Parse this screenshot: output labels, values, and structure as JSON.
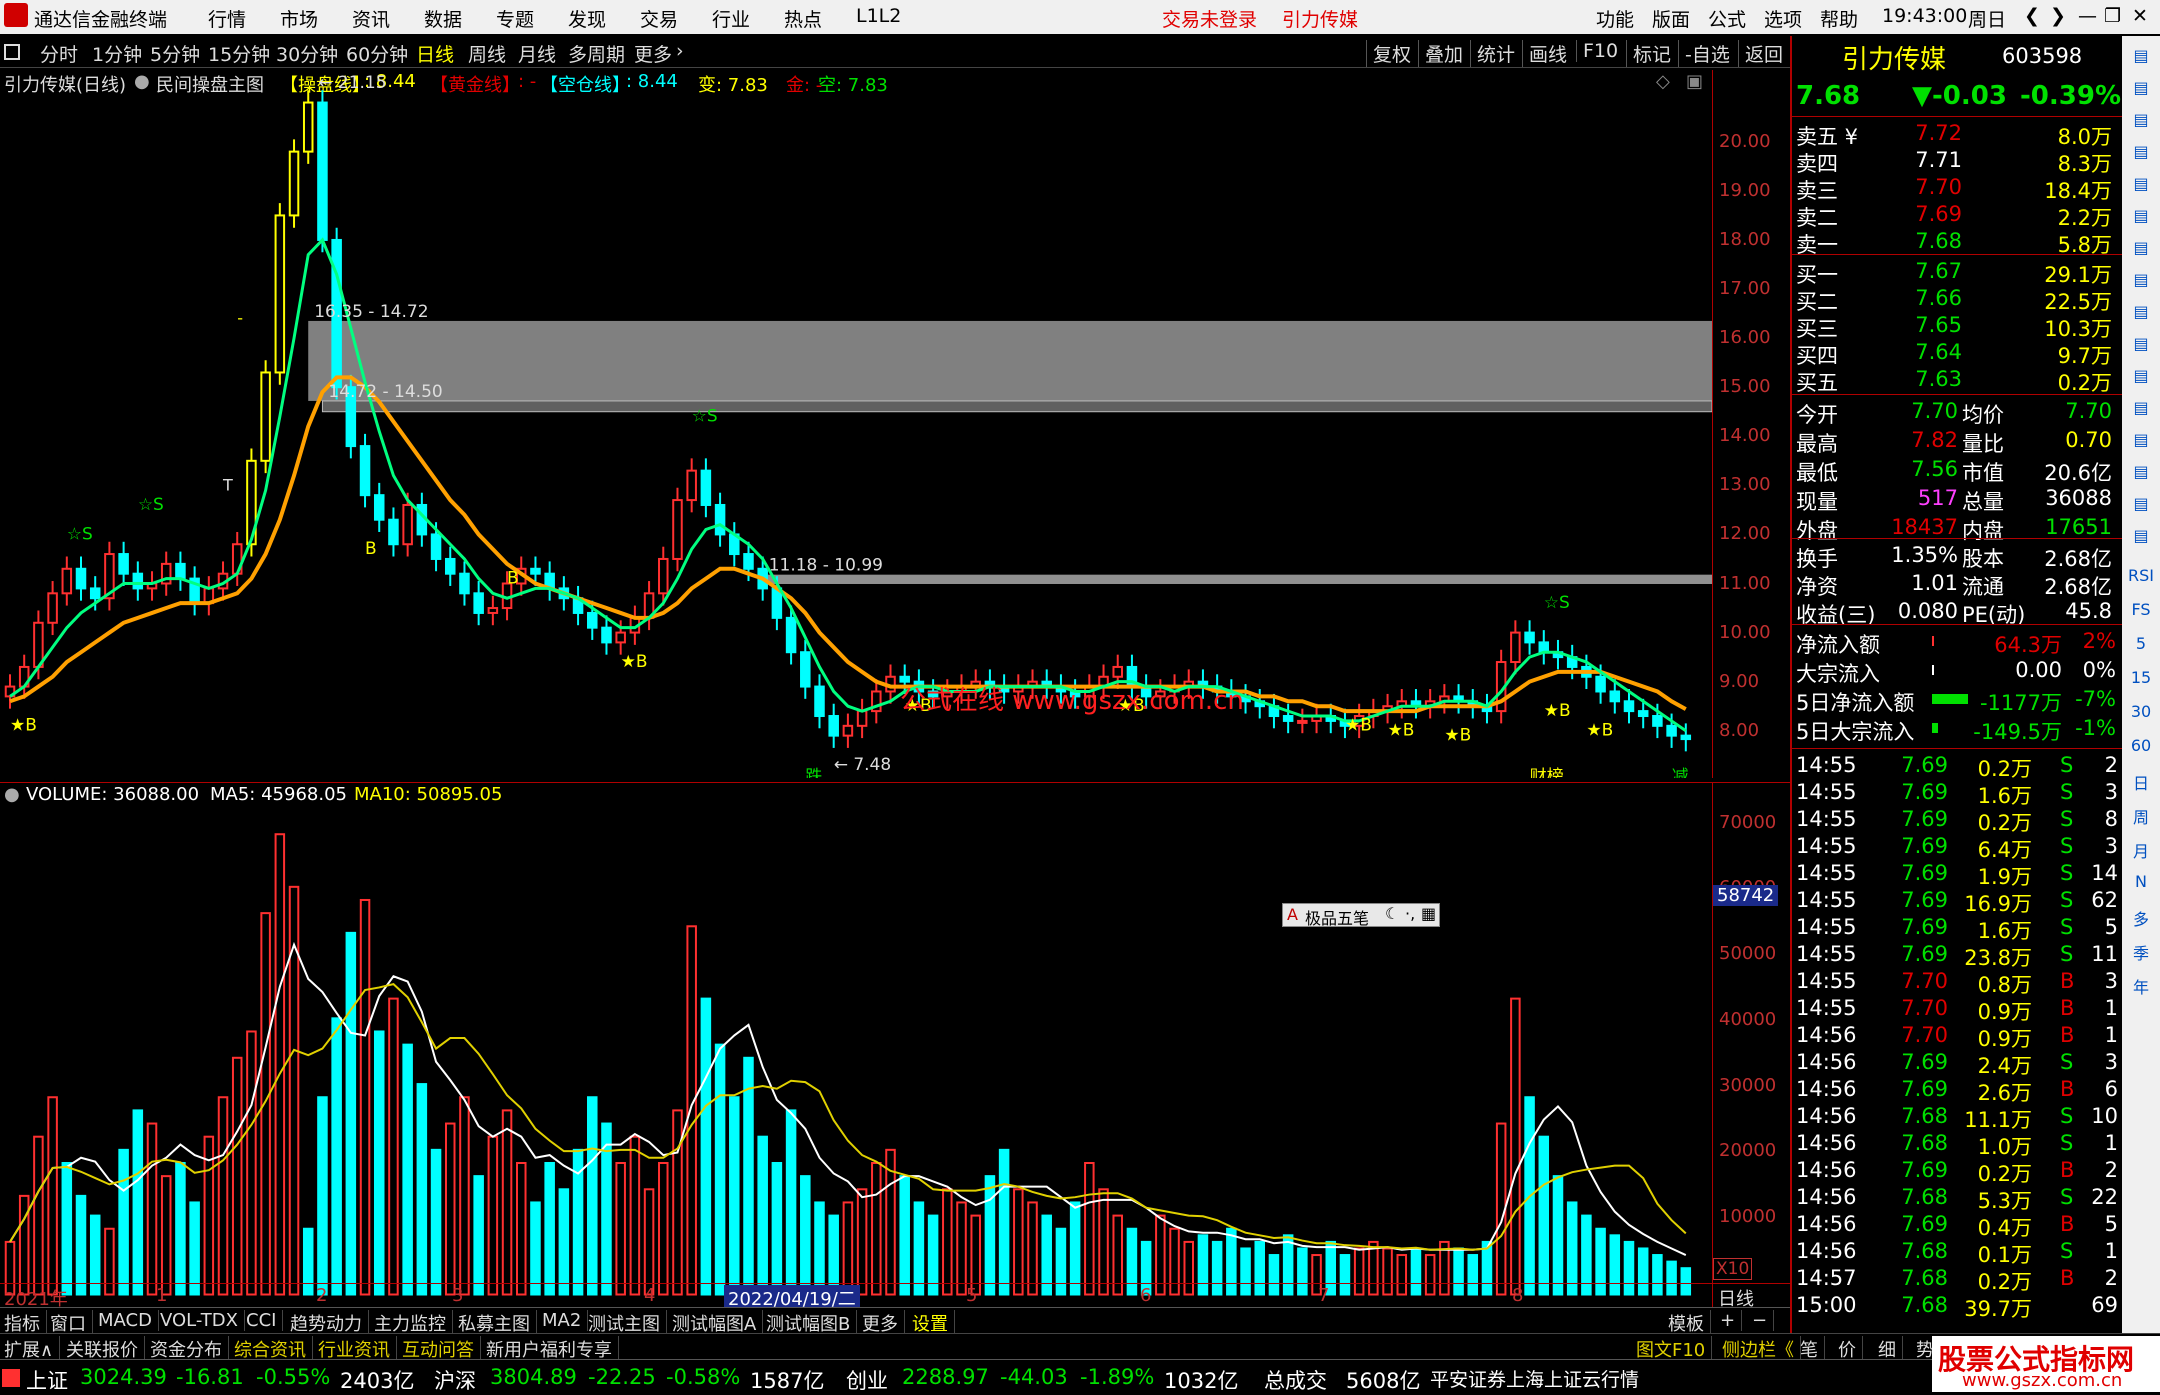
{
  "menubar": {
    "app_title": "通达信金融终端",
    "items": [
      "行情",
      "市场",
      "资讯",
      "数据",
      "专题",
      "发现",
      "交易",
      "行业",
      "热点",
      "L1L2"
    ],
    "notice_login": "交易未登录",
    "notice_stock": "引力传媒",
    "right_items": [
      "功能",
      "版面",
      "公式",
      "选项",
      "帮助"
    ],
    "time": "19:43:00",
    "weekday": "周日"
  },
  "periodbar": {
    "items": [
      "分时",
      "1分钟",
      "5分钟",
      "15分钟",
      "30分钟",
      "60分钟",
      "日线",
      "周线",
      "月线",
      "多周期",
      "更多"
    ],
    "active": "日线",
    "right_items": [
      "复权",
      "叠加",
      "统计",
      "画线",
      "F10",
      "标记",
      "-自选",
      "返回"
    ]
  },
  "legend": {
    "stock": "引力传媒(日线)",
    "indicator": "民间操盘主图",
    "line1_label": "【操盘线】",
    "line1_value": ": 8.44",
    "line2_label": "【黄金线】",
    "line2_value": ": -",
    "line3_label": "【空仓线】",
    "line3_value": ": 8.44",
    "bian": "变: 7.83",
    "jin": "金: -",
    "kong": "空: 7.83"
  },
  "chart_annotations": {
    "high_label": "21.15",
    "low_label": "7.48",
    "zone1": "16.35 - 14.72",
    "zone2": "14.72 - 14.50",
    "zone3": "11.18 - 10.99",
    "signals": [
      "☆S",
      "☆S",
      "☆S",
      "☆S",
      "★B",
      "★B",
      "★B",
      "★B",
      "★B",
      "★B",
      "★B",
      "★B",
      "★B",
      "B",
      "B",
      "T",
      "-"
    ],
    "tags": [
      "跌",
      "财榜",
      "减"
    ],
    "watermark": "公式在线 www.gszx.com.cn"
  },
  "volume_legend": {
    "volume": "VOLUME: 36088.00",
    "ma5": "MA5: 45968.05",
    "ma10": "MA10: 50895.05"
  },
  "chart_data": [
    {
      "type": "line",
      "name": "price",
      "ylim": [
        7.2,
        21.3
      ],
      "yticks": [
        "20.00",
        "19.00",
        "18.00",
        "17.00",
        "16.00",
        "15.00",
        "14.00",
        "13.00",
        "12.00",
        "11.00",
        "10.00",
        "9.00",
        "8.00"
      ],
      "close": [
        8.9,
        9.3,
        10.2,
        10.8,
        11.3,
        10.9,
        10.7,
        11.6,
        11.2,
        10.9,
        11.0,
        11.4,
        11.1,
        10.6,
        10.9,
        11.2,
        11.8,
        13.5,
        15.3,
        18.5,
        19.8,
        20.8,
        18.0,
        15.0,
        13.8,
        12.8,
        12.3,
        11.8,
        12.6,
        12.0,
        11.5,
        11.2,
        10.8,
        10.4,
        10.5,
        11.0,
        11.3,
        11.2,
        10.9,
        10.7,
        10.4,
        10.1,
        9.8,
        10.0,
        10.3,
        10.8,
        11.5,
        12.7,
        13.3,
        12.6,
        12.0,
        11.6,
        11.3,
        10.9,
        10.3,
        9.6,
        8.9,
        8.3,
        7.9,
        8.1,
        8.4,
        8.8,
        9.1,
        9.0,
        8.8,
        8.7,
        8.8,
        8.9,
        9.0,
        8.9,
        8.8,
        8.9,
        9.0,
        8.9,
        8.8,
        8.7,
        8.9,
        9.1,
        9.3,
        8.9,
        8.7,
        8.8,
        8.9,
        9.0,
        8.9,
        8.8,
        8.7,
        8.6,
        8.5,
        8.3,
        8.2,
        8.2,
        8.3,
        8.2,
        8.1,
        8.3,
        8.4,
        8.5,
        8.6,
        8.5,
        8.6,
        8.7,
        8.6,
        8.5,
        8.4,
        9.4,
        10.0,
        9.8,
        9.6,
        9.5,
        9.3,
        9.1,
        8.8,
        8.6,
        8.4,
        8.3,
        8.1,
        7.9,
        7.83
      ],
      "ma_fast": [
        8.7,
        8.9,
        9.3,
        9.7,
        10.1,
        10.4,
        10.6,
        10.8,
        11.0,
        11.0,
        11.0,
        11.1,
        11.1,
        11.0,
        10.9,
        11.0,
        11.2,
        11.9,
        12.9,
        14.4,
        16.0,
        17.7,
        18.0,
        17.3,
        16.2,
        15.1,
        14.1,
        13.2,
        12.7,
        12.4,
        12.1,
        11.8,
        11.5,
        11.1,
        10.8,
        10.7,
        10.8,
        10.9,
        10.9,
        10.8,
        10.7,
        10.5,
        10.3,
        10.1,
        10.1,
        10.3,
        10.6,
        11.1,
        11.7,
        12.1,
        12.2,
        12.0,
        11.8,
        11.5,
        11.0,
        10.5,
        9.9,
        9.3,
        8.8,
        8.5,
        8.4,
        8.5,
        8.6,
        8.8,
        8.9,
        8.9,
        8.8,
        8.8,
        8.8,
        8.9,
        8.9,
        8.9,
        8.9,
        8.9,
        8.9,
        8.8,
        8.8,
        8.9,
        9.0,
        9.0,
        8.9,
        8.9,
        8.8,
        8.9,
        8.9,
        8.9,
        8.8,
        8.7,
        8.6,
        8.5,
        8.4,
        8.3,
        8.3,
        8.3,
        8.2,
        8.2,
        8.3,
        8.4,
        8.5,
        8.5,
        8.5,
        8.6,
        8.6,
        8.6,
        8.5,
        8.8,
        9.2,
        9.5,
        9.6,
        9.6,
        9.5,
        9.4,
        9.2,
        9.0,
        8.8,
        8.6,
        8.4,
        8.2,
        8.0
      ],
      "ma_slow": [
        8.6,
        8.7,
        8.9,
        9.1,
        9.4,
        9.6,
        9.8,
        10.0,
        10.2,
        10.3,
        10.4,
        10.5,
        10.6,
        10.6,
        10.6,
        10.7,
        10.8,
        11.1,
        11.6,
        12.3,
        13.2,
        14.2,
        14.9,
        15.2,
        15.2,
        15.0,
        14.7,
        14.3,
        13.9,
        13.5,
        13.1,
        12.7,
        12.4,
        12.0,
        11.7,
        11.4,
        11.2,
        11.0,
        10.9,
        10.8,
        10.7,
        10.6,
        10.5,
        10.4,
        10.3,
        10.3,
        10.4,
        10.6,
        10.9,
        11.1,
        11.3,
        11.3,
        11.2,
        11.1,
        10.9,
        10.7,
        10.4,
        10.0,
        9.7,
        9.4,
        9.2,
        9.0,
        8.9,
        8.9,
        8.9,
        8.9,
        8.9,
        8.9,
        8.9,
        8.9,
        8.9,
        8.9,
        8.9,
        8.9,
        8.9,
        8.9,
        8.9,
        8.9,
        8.9,
        8.9,
        8.9,
        8.9,
        8.9,
        8.9,
        8.9,
        8.8,
        8.8,
        8.8,
        8.7,
        8.7,
        8.6,
        8.6,
        8.5,
        8.5,
        8.4,
        8.4,
        8.4,
        8.4,
        8.4,
        8.4,
        8.5,
        8.5,
        8.5,
        8.5,
        8.5,
        8.6,
        8.8,
        9.0,
        9.1,
        9.2,
        9.2,
        9.2,
        9.2,
        9.1,
        9.0,
        8.9,
        8.8,
        8.6,
        8.44
      ]
    },
    {
      "type": "bar",
      "name": "volume",
      "ylim": [
        0,
        73000
      ],
      "yticks": [
        "70000",
        "60000",
        "50000",
        "40000",
        "30000",
        "20000",
        "10000"
      ],
      "axis_marker": "58742",
      "multiplier": "X10",
      "values": [
        8000,
        15000,
        24000,
        30000,
        20000,
        15000,
        12000,
        10000,
        22000,
        28000,
        26000,
        18000,
        20000,
        14000,
        24000,
        30000,
        36000,
        40000,
        58000,
        70000,
        62000,
        10000,
        30000,
        42000,
        55000,
        60000,
        40000,
        45000,
        38000,
        32000,
        22000,
        26000,
        30000,
        18000,
        24000,
        28000,
        20000,
        14000,
        20000,
        16000,
        22000,
        30000,
        26000,
        20000,
        24000,
        16000,
        20000,
        28000,
        56000,
        45000,
        38000,
        30000,
        36000,
        24000,
        20000,
        28000,
        18000,
        14000,
        12000,
        14000,
        16000,
        20000,
        22000,
        18000,
        14000,
        12000,
        16000,
        14000,
        12000,
        18000,
        22000,
        16000,
        14000,
        12000,
        10000,
        14000,
        20000,
        16000,
        12000,
        10000,
        8000,
        12000,
        10000,
        8000,
        9000,
        8000,
        10000,
        7000,
        8000,
        6000,
        9000,
        7000,
        6000,
        8000,
        6000,
        7000,
        8000,
        7000,
        6000,
        7000,
        6000,
        8000,
        7000,
        6000,
        8000,
        26000,
        45000,
        30000,
        24000,
        18000,
        14000,
        12000,
        10000,
        9000,
        8000,
        7000,
        6000,
        5000,
        4000
      ],
      "up": [
        1,
        1,
        1,
        1,
        0,
        0,
        0,
        1,
        0,
        0,
        1,
        1,
        0,
        0,
        1,
        1,
        1,
        1,
        1,
        1,
        1,
        0,
        0,
        0,
        0,
        1,
        0,
        1,
        0,
        0,
        0,
        1,
        1,
        0,
        1,
        1,
        1,
        0,
        0,
        0,
        0,
        0,
        0,
        1,
        1,
        1,
        1,
        1,
        1,
        0,
        0,
        0,
        0,
        0,
        0,
        0,
        0,
        0,
        0,
        1,
        1,
        1,
        1,
        0,
        0,
        0,
        1,
        1,
        1,
        0,
        0,
        1,
        1,
        0,
        0,
        0,
        1,
        1,
        1,
        0,
        0,
        1,
        1,
        1,
        0,
        0,
        0,
        0,
        0,
        0,
        0,
        0,
        1,
        0,
        0,
        1,
        1,
        1,
        1,
        0,
        1,
        1,
        0,
        0,
        0,
        1,
        1,
        0,
        0,
        0,
        0,
        0,
        0,
        0,
        0,
        0,
        0,
        0,
        0,
        0
      ]
    }
  ],
  "date_axis": {
    "labels": [
      "2021年",
      "1",
      "2",
      "3",
      "4",
      "2022/04/19/二",
      "5",
      "6",
      "7",
      "8",
      "9"
    ],
    "right_label": "日线"
  },
  "tabs1": [
    "指标",
    "窗口",
    "MACD",
    "VOL-TDX",
    "CCI",
    "趋势动力",
    "主力监控",
    "私募主图",
    "MA2",
    "测试主图",
    "测试幅图A",
    "测试幅图B",
    "更多",
    "设置"
  ],
  "tabs1_right": [
    "模板",
    "+",
    "−"
  ],
  "tabs2": [
    "扩展∧",
    "关联报价",
    "资金分布",
    "综合资讯",
    "行业资讯",
    "互动问答",
    "新用户福利专享"
  ],
  "tabs2_right": [
    "图文F10",
    "侧边栏《",
    "笔",
    "价",
    "细",
    "势"
  ],
  "indexbar": {
    "sh_name": "上证",
    "sh_val": "3024.39",
    "sh_chg": "-16.81",
    "sh_pct": "-0.55%",
    "sh_amt": "2403亿",
    "hs_name": "沪深",
    "hs_val": "3804.89",
    "hs_chg": "-22.25",
    "hs_pct": "-0.58%",
    "hs_amt": "1587亿",
    "cy_name": "创业",
    "cy_val": "2288.97",
    "cy_chg": "-44.03",
    "cy_pct": "-1.89%",
    "cy_amt": "1032亿",
    "total_label": "总成交",
    "total_amt": "5608亿",
    "broker": "平安证券上海上证云行情"
  },
  "quote": {
    "name": "引力传媒",
    "code": "603598",
    "price": "7.68",
    "change": "▼-0.03",
    "pct": "-0.39%",
    "asks": [
      {
        "label": "卖五 ¥",
        "price": "7.72",
        "vol": "8.0万"
      },
      {
        "label": "卖四",
        "price": "7.71",
        "vol": "8.3万"
      },
      {
        "label": "卖三",
        "price": "7.70",
        "vol": "18.4万"
      },
      {
        "label": "卖二",
        "price": "7.69",
        "vol": "2.2万"
      },
      {
        "label": "卖一",
        "price": "7.68",
        "vol": "5.8万"
      }
    ],
    "bids": [
      {
        "label": "买一",
        "price": "7.67",
        "vol": "29.1万"
      },
      {
        "label": "买二",
        "price": "7.66",
        "vol": "22.5万"
      },
      {
        "label": "买三",
        "price": "7.65",
        "vol": "10.3万"
      },
      {
        "label": "买四",
        "price": "7.64",
        "vol": "9.7万"
      },
      {
        "label": "买五",
        "price": "7.63",
        "vol": "0.2万"
      }
    ],
    "stats": [
      {
        "l1": "今开",
        "v1": "7.70",
        "l2": "均价",
        "v2": "7.70"
      },
      {
        "l1": "最高",
        "v1": "7.82",
        "l2": "量比",
        "v2": "0.70"
      },
      {
        "l1": "最低",
        "v1": "7.56",
        "l2": "市值",
        "v2": "20.6亿"
      },
      {
        "l1": "现量",
        "v1": "517",
        "l2": "总量",
        "v2": "36088"
      },
      {
        "l1": "外盘",
        "v1": "18437",
        "l2": "内盘",
        "v2": "17651"
      }
    ],
    "fund": [
      {
        "l1": "换手",
        "v1": "1.35%",
        "l2": "股本",
        "v2": "2.68亿"
      },
      {
        "l1": "净资",
        "v1": "1.01",
        "l2": "流通",
        "v2": "2.68亿"
      },
      {
        "l1": "收益(三)",
        "v1": "0.080",
        "l2": "PE(动)",
        "v2": "45.8"
      }
    ],
    "flow": [
      {
        "label": "净流入额",
        "val": "64.3万",
        "pct": "2%"
      },
      {
        "label": "大宗流入",
        "val": "0.00",
        "pct": "0%"
      },
      {
        "label": "5日净流入额",
        "val": "-1177万",
        "pct": "-7%"
      },
      {
        "label": "5日大宗流入",
        "val": "-149.5万",
        "pct": "-1%"
      }
    ],
    "ticks": [
      {
        "t": "14:55",
        "p": "7.69",
        "v": "0.2万",
        "s": "S",
        "n": "2"
      },
      {
        "t": "14:55",
        "p": "7.69",
        "v": "1.6万",
        "s": "S",
        "n": "3"
      },
      {
        "t": "14:55",
        "p": "7.69",
        "v": "0.2万",
        "s": "S",
        "n": "8"
      },
      {
        "t": "14:55",
        "p": "7.69",
        "v": "6.4万",
        "s": "S",
        "n": "3"
      },
      {
        "t": "14:55",
        "p": "7.69",
        "v": "1.9万",
        "s": "S",
        "n": "14"
      },
      {
        "t": "14:55",
        "p": "7.69",
        "v": "16.9万",
        "s": "S",
        "n": "62"
      },
      {
        "t": "14:55",
        "p": "7.69",
        "v": "1.6万",
        "s": "S",
        "n": "5"
      },
      {
        "t": "14:55",
        "p": "7.69",
        "v": "23.8万",
        "s": "S",
        "n": "11"
      },
      {
        "t": "14:55",
        "p": "7.70",
        "v": "0.8万",
        "s": "B",
        "n": "3"
      },
      {
        "t": "14:55",
        "p": "7.70",
        "v": "0.9万",
        "s": "B",
        "n": "1"
      },
      {
        "t": "14:56",
        "p": "7.70",
        "v": "0.9万",
        "s": "B",
        "n": "1"
      },
      {
        "t": "14:56",
        "p": "7.69",
        "v": "2.4万",
        "s": "S",
        "n": "3"
      },
      {
        "t": "14:56",
        "p": "7.69",
        "v": "2.6万",
        "s": "B",
        "n": "6"
      },
      {
        "t": "14:56",
        "p": "7.68",
        "v": "11.1万",
        "s": "S",
        "n": "10"
      },
      {
        "t": "14:56",
        "p": "7.68",
        "v": "1.0万",
        "s": "S",
        "n": "1"
      },
      {
        "t": "14:56",
        "p": "7.69",
        "v": "0.2万",
        "s": "B",
        "n": "2"
      },
      {
        "t": "14:56",
        "p": "7.68",
        "v": "5.3万",
        "s": "S",
        "n": "22"
      },
      {
        "t": "14:56",
        "p": "7.69",
        "v": "0.4万",
        "s": "B",
        "n": "5"
      },
      {
        "t": "14:56",
        "p": "7.68",
        "v": "0.1万",
        "s": "S",
        "n": "1"
      },
      {
        "t": "14:57",
        "p": "7.68",
        "v": "0.2万",
        "s": "B",
        "n": "2"
      },
      {
        "t": "15:00",
        "p": "7.68",
        "v": "39.7万",
        "s": "",
        "n": "69"
      }
    ]
  },
  "sidebar": [
    "RSI",
    "FS",
    "5",
    "15",
    "30",
    "60",
    "日",
    "周",
    "月",
    "N",
    "多",
    "季",
    "年"
  ],
  "ime": {
    "label": "极品五笔"
  },
  "logo_banner": {
    "title": "股票公式指标网",
    "url": "www.gszx.com.cn"
  },
  "colors": {
    "up": "#ff3030",
    "down": "#00ffff",
    "ma_fast": "#00ff80",
    "ma_slow": "#ffa000",
    "grid": "#b00000",
    "zone": "#808080"
  }
}
